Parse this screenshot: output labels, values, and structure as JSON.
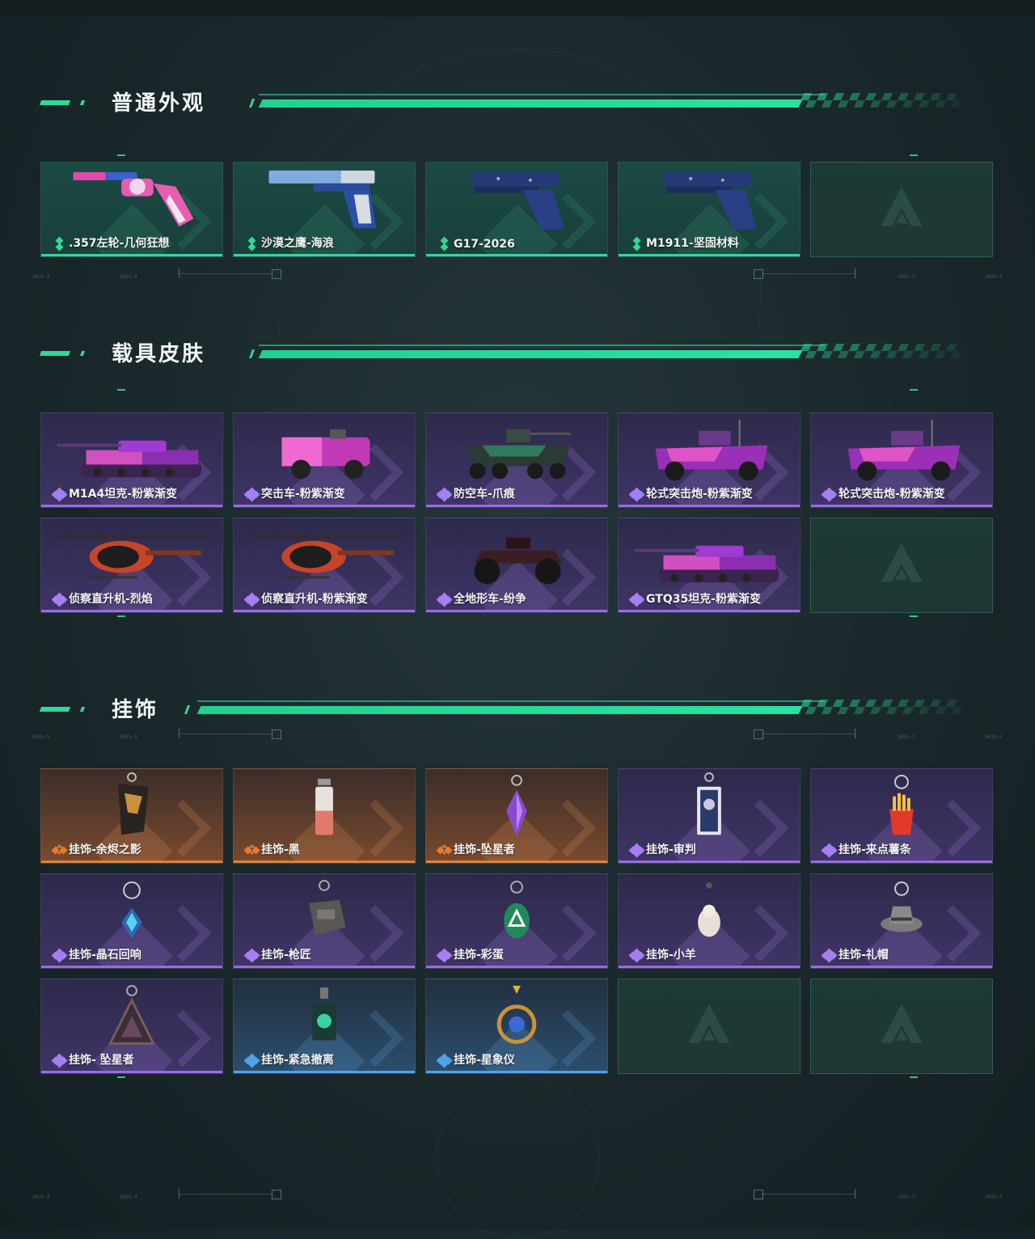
{
  "sections": [
    {
      "title": "普通外观",
      "items": [
        {
          "label": ".357左轮-几何狂想",
          "rarity": "green",
          "icon": "revolver-icon"
        },
        {
          "label": "沙漠之鹰-海浪",
          "rarity": "green",
          "icon": "desert-eagle-icon"
        },
        {
          "label": "G17-2026",
          "rarity": "green",
          "icon": "pistol-icon"
        },
        {
          "label": "M1911-坚固材料",
          "rarity": "green",
          "icon": "pistol-icon"
        },
        {
          "label": "",
          "rarity": "empty",
          "icon": "logo-placeholder-icon"
        }
      ]
    },
    {
      "title": "载具皮肤",
      "items": [
        {
          "label": "M1A4坦克-粉紫渐变",
          "rarity": "purple",
          "icon": "tank-icon"
        },
        {
          "label": "突击车-粉紫渐变",
          "rarity": "purple",
          "icon": "assault-vehicle-icon"
        },
        {
          "label": "防空车-爪痕",
          "rarity": "purple",
          "icon": "aa-vehicle-icon"
        },
        {
          "label": "轮式突击炮-粉紫渐变",
          "rarity": "purple",
          "icon": "wheeled-gun-icon"
        },
        {
          "label": "轮式突击炮-粉紫渐变",
          "rarity": "purple",
          "icon": "wheeled-gun-icon"
        },
        {
          "label": "侦察直升机-烈焰",
          "rarity": "purple",
          "icon": "helicopter-icon"
        },
        {
          "label": "侦察直升机-粉紫渐变",
          "rarity": "purple",
          "icon": "helicopter-icon"
        },
        {
          "label": "全地形车-纷争",
          "rarity": "purple",
          "icon": "atv-icon"
        },
        {
          "label": "GTQ35坦克-粉紫渐变",
          "rarity": "purple",
          "icon": "tank-icon"
        },
        {
          "label": "",
          "rarity": "empty",
          "icon": "logo-placeholder-icon"
        }
      ]
    },
    {
      "title": "挂饰",
      "items": [
        {
          "label": "挂饰-余烬之影",
          "rarity": "orange",
          "icon": "charm-figure-icon"
        },
        {
          "label": "挂饰-黑",
          "rarity": "orange",
          "icon": "charm-tag-icon"
        },
        {
          "label": "挂饰-坠星者",
          "rarity": "orange",
          "icon": "charm-crystal-icon"
        },
        {
          "label": "挂饰-审判",
          "rarity": "purple",
          "icon": "charm-card-icon"
        },
        {
          "label": "挂饰-来点薯条",
          "rarity": "purple",
          "icon": "charm-fries-icon"
        },
        {
          "label": "挂饰-晶石回响",
          "rarity": "purple",
          "icon": "charm-gem-icon"
        },
        {
          "label": "挂饰-枪匠",
          "rarity": "purple",
          "icon": "charm-badge-icon"
        },
        {
          "label": "挂饰-彩蛋",
          "rarity": "purple",
          "icon": "charm-egg-icon"
        },
        {
          "label": "挂饰-小羊",
          "rarity": "purple",
          "icon": "charm-sheep-icon"
        },
        {
          "label": "挂饰-礼帽",
          "rarity": "purple",
          "icon": "charm-hat-icon"
        },
        {
          "label": "挂饰- 坠星者",
          "rarity": "purple",
          "icon": "charm-triangle-icon"
        },
        {
          "label": "挂饰-紧急撤离",
          "rarity": "blue",
          "icon": "charm-block-icon"
        },
        {
          "label": "挂饰-星象仪",
          "rarity": "blue",
          "icon": "charm-astrolabe-icon"
        },
        {
          "label": "",
          "rarity": "empty",
          "icon": "logo-placeholder-icon"
        },
        {
          "label": "",
          "rarity": "empty",
          "icon": "logo-placeholder-icon"
        }
      ]
    }
  ],
  "deco_text": {
    "code_a": "2035-5",
    "code_b": "1955-3"
  },
  "colors": {
    "green": "#2fd99a",
    "purple": "#9a6be3",
    "orange": "#e0823a",
    "blue": "#4fa3e8",
    "background": "#1b2a2d"
  }
}
